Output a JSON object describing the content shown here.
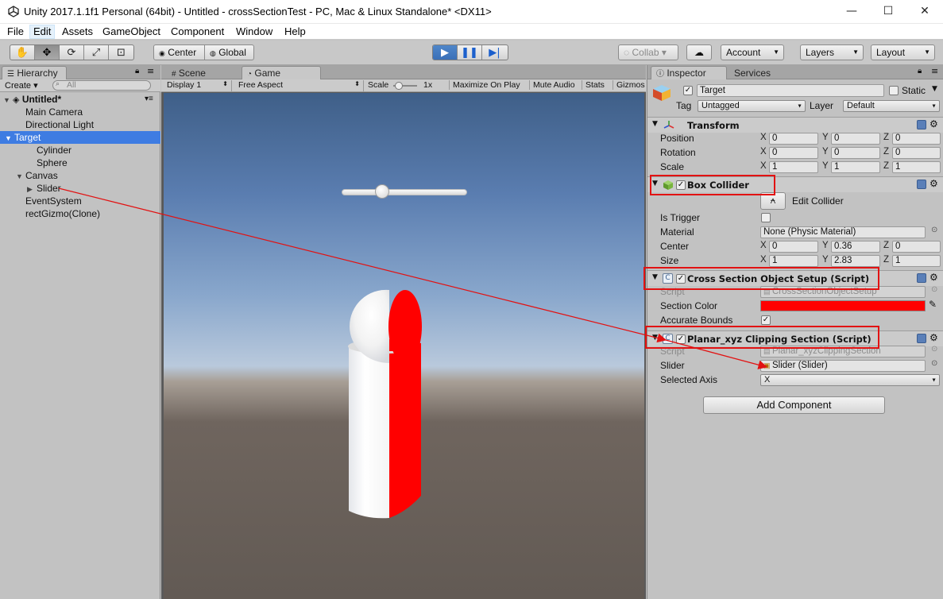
{
  "window": {
    "title": "Unity 2017.1.1f1 Personal (64bit) - Untitled - crossSectionTest - PC, Mac & Linux Standalone* <DX11>",
    "minimize": "—",
    "maximize": "☐",
    "close": "✕"
  },
  "menu": {
    "items": [
      "File",
      "Edit",
      "Assets",
      "GameObject",
      "Component",
      "Window",
      "Help"
    ]
  },
  "toolbar": {
    "center_label": "Center",
    "global_label": "Global",
    "collab_label": "Collab ▾",
    "account_label": "Account",
    "layers_label": "Layers",
    "layout_label": "Layout"
  },
  "hierarchy": {
    "tab_label": "Hierarchy",
    "create_label": "Create ▾",
    "search_placeholder": "All",
    "scene_name": "Untitled*",
    "rows": [
      "Main Camera",
      "Directional Light",
      "Target",
      "Cylinder",
      "Sphere",
      "Canvas",
      "Slider",
      "EventSystem",
      "rectGizmo(Clone)"
    ]
  },
  "game": {
    "tabs": [
      "Scene",
      "Game"
    ],
    "display": "Display 1",
    "aspect": "Free Aspect",
    "scale_label": "Scale",
    "scale_value": "1x",
    "maximize_on_play": "Maximize On Play",
    "mute_audio": "Mute Audio",
    "stats": "Stats",
    "gizmos": "Gizmos",
    "slider_value": 0.3
  },
  "inspector": {
    "tabs": [
      "Inspector",
      "Services"
    ],
    "object_name": "Target",
    "static_label": "Static",
    "tag_label": "Tag",
    "tag_value": "Untagged",
    "layer_label": "Layer",
    "layer_value": "Default",
    "transform": {
      "title": "Transform",
      "position_label": "Position",
      "rotation_label": "Rotation",
      "scale_label": "Scale",
      "position": [
        "0",
        "0",
        "0"
      ],
      "rotation": [
        "0",
        "0",
        "0"
      ],
      "scale": [
        "1",
        "1",
        "1"
      ]
    },
    "box_collider": {
      "title": "Box Collider",
      "edit_collider": "Edit Collider",
      "is_trigger_label": "Is Trigger",
      "material_label": "Material",
      "material_value": "None (Physic Material)",
      "center_label": "Center",
      "center": [
        "0",
        "0.36",
        "0"
      ],
      "size_label": "Size",
      "size": [
        "1",
        "2.83",
        "1"
      ]
    },
    "cross_section": {
      "title": "Cross Section Object Setup (Script)",
      "script_label": "Script",
      "script_value": "CrossSectionObjectSetup",
      "section_color_label": "Section Color",
      "section_color": "#ff0000",
      "accurate_bounds_label": "Accurate Bounds"
    },
    "planar": {
      "title": "Planar_xyz Clipping Section (Script)",
      "script_label": "Script",
      "script_value": "Planar_xyzClippingSection",
      "slider_label": "Slider",
      "slider_value": "Slider (Slider)",
      "selected_axis_label": "Selected Axis",
      "selected_axis_value": "X"
    },
    "add_component": "Add Component",
    "axis_x": "X",
    "axis_y": "Y",
    "axis_z": "Z"
  }
}
